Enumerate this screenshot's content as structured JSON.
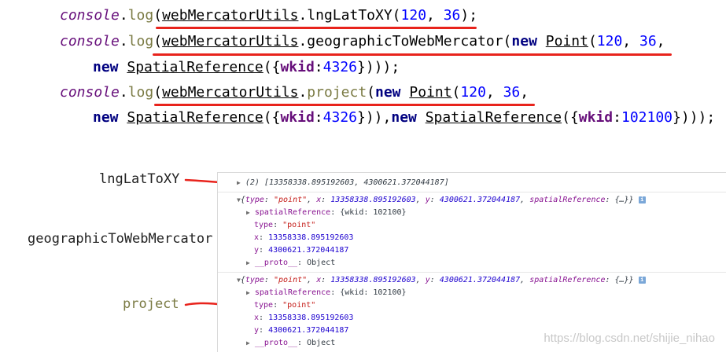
{
  "code": {
    "console": "console",
    "dot": ".",
    "log": "log",
    "paren_open": "(",
    "utils": "webMercatorUtils",
    "fn_lnglat": "lngLatToXY",
    "fn_geo": "geographicToWebMercator",
    "fn_project": "project",
    "new_kw": "new",
    "point_cls": "Point",
    "sr_cls": "SpatialReference",
    "wkid_key": "wkid",
    "num_120": "120",
    "num_36": "36",
    "num_4326": "4326",
    "num_102100": "102100",
    "comma_sp": ", ",
    "line1_tail": ");",
    "line2_tail": ",",
    "line3_open": "({",
    "line3_colon": ":",
    "line3_tail": "})));",
    "line5_mid": "})),",
    "line5_tail": "})));"
  },
  "labels": {
    "lnglat": "lngLatToXY",
    "geo": "geographicToWebMercator",
    "project": "project"
  },
  "console": {
    "row1": "(2) [13358338.895192603, 4300621.372044187]",
    "obj_open": "{",
    "type_key": "type",
    "type_val": "\"point\"",
    "x_key": "x",
    "x_val": "13358338.895192603",
    "y_key": "y",
    "y_val": "4300621.372044187",
    "sr_key": "spatialReference",
    "sr_collapsed": "{…}",
    "obj_close": "}",
    "sr_expanded_val": "{wkid: 102100}",
    "proto_key": "__proto__",
    "proto_val": "Object",
    "colon_sp": ": ",
    "comma_sp": ", ",
    "info": "i"
  },
  "watermark": "https://blog.csdn.net/shijie_nihao"
}
